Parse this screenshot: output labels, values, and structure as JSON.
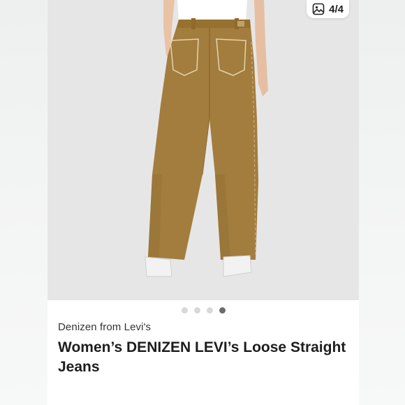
{
  "gallery": {
    "counter": "4/4",
    "total_images": 4,
    "active_index": 4,
    "image_alt": "Women's DENIZEN LEVI's Loose Straight Jeans back view"
  },
  "product": {
    "brand": "Denizen from Levi's",
    "title": "Women’s DENIZEN LEVI’s Loose Straight Jeans"
  },
  "icons": {
    "counter_icon": "image-icon"
  },
  "colors": {
    "photo_bg": "#e6e6e6",
    "pants": "#a37d3e",
    "active_dot": "#6b6b6b",
    "inactive_dot": "#d8d8d8"
  }
}
